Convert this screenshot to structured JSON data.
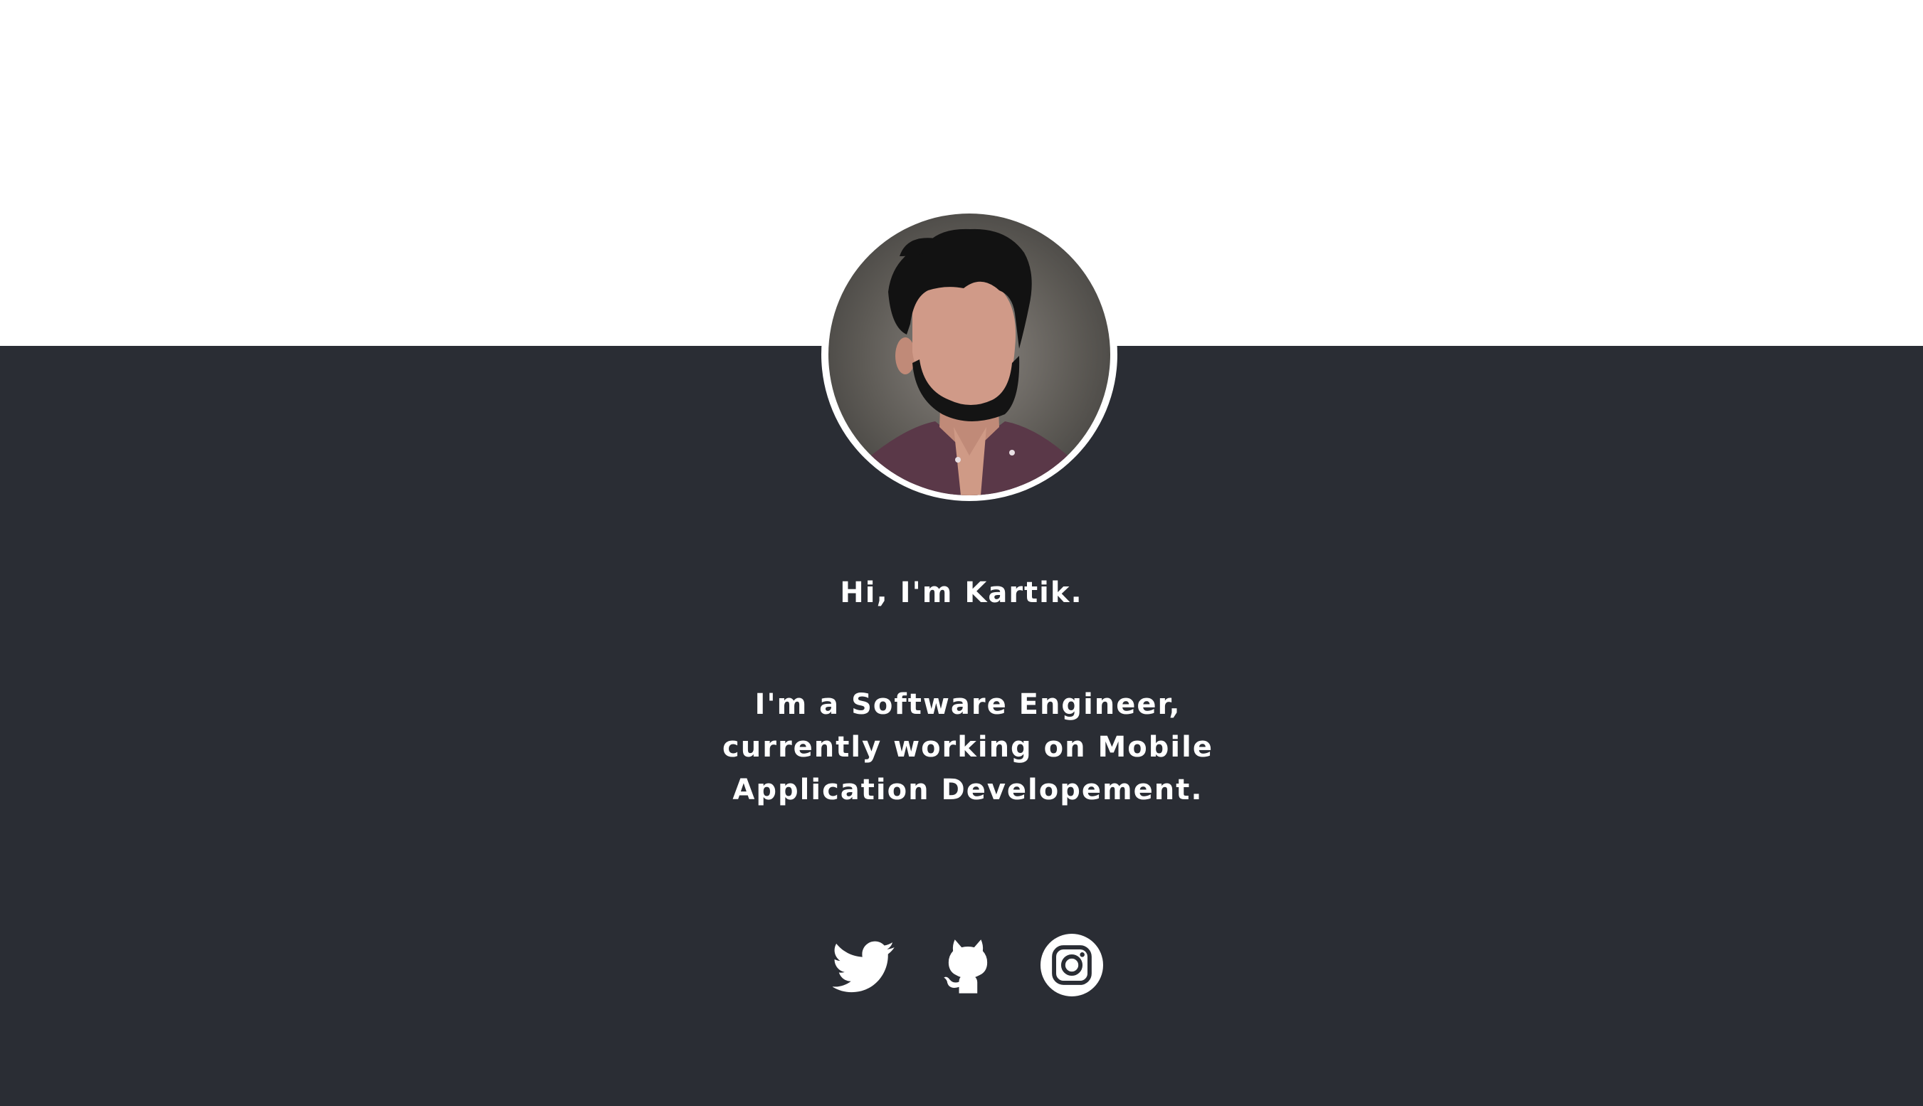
{
  "hero": {
    "greeting": "Hi, I'm Kartik.",
    "bio": "I'm a Software Engineer, currently working on Mobile Application Developement."
  },
  "avatar": {
    "icon": "person-illustration"
  },
  "socials": [
    {
      "icon": "twitter-icon"
    },
    {
      "icon": "github-icon"
    },
    {
      "icon": "instagram-icon"
    }
  ],
  "colors": {
    "top_background": "#ffffff",
    "bottom_background": "#2a2d34",
    "text": "#ffffff",
    "icon": "#ffffff"
  }
}
